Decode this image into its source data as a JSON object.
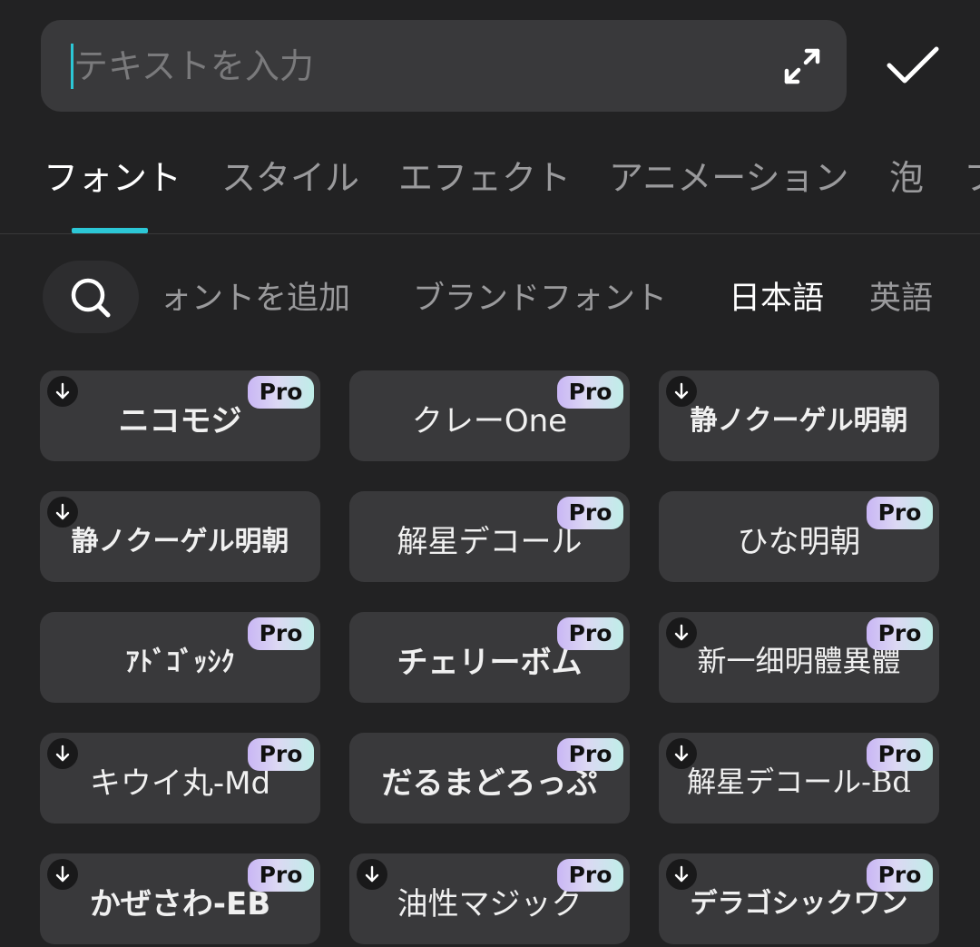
{
  "input": {
    "placeholder": "テキストを入力",
    "value": ""
  },
  "header": {
    "expand_icon": "expand-arrows-icon",
    "confirm_icon": "checkmark-icon"
  },
  "tabs": [
    {
      "label": "フォント",
      "active": true
    },
    {
      "label": "スタイル"
    },
    {
      "label": "エフェクト"
    },
    {
      "label": "アニメーション"
    },
    {
      "label": "泡"
    },
    {
      "label": "フ"
    }
  ],
  "filters": {
    "search_icon": "search-icon",
    "chips": [
      {
        "label": "ォントを追加"
      },
      {
        "label": "ブランドフォント"
      },
      {
        "label": "日本語",
        "selected": true
      },
      {
        "label": "英語"
      }
    ]
  },
  "fonts": [
    {
      "name": "ニコモジ",
      "download": true,
      "pro": true
    },
    {
      "name": "クレーOne",
      "download": false,
      "pro": true
    },
    {
      "name": "静ノクーゲル明朝",
      "download": true,
      "pro": false
    },
    {
      "name": "静ノクーゲル明朝",
      "download": true,
      "pro": false
    },
    {
      "name": "解星デコール",
      "download": false,
      "pro": true
    },
    {
      "name": "ひな明朝",
      "download": false,
      "pro": true
    },
    {
      "name": "ｱﾄﾞｺﾞｯｼｸ",
      "download": false,
      "pro": true
    },
    {
      "name": "チェリーボム",
      "download": false,
      "pro": true
    },
    {
      "name": "新一细明體異體",
      "download": true,
      "pro": true
    },
    {
      "name": "キウイ丸-Md",
      "download": true,
      "pro": true
    },
    {
      "name": "だるまどろっぷ",
      "download": false,
      "pro": true
    },
    {
      "name": "解星デコール-Bd",
      "download": true,
      "pro": true
    },
    {
      "name": "かぜさわ-EB",
      "download": true,
      "pro": true
    },
    {
      "name": "油性マジック",
      "download": true,
      "pro": true
    },
    {
      "name": "デラゴシックワン",
      "download": true,
      "pro": true
    }
  ],
  "pro_label": "Pro",
  "colors": {
    "accent": "#2cc7d6",
    "background": "#222223",
    "card": "#39393b"
  }
}
